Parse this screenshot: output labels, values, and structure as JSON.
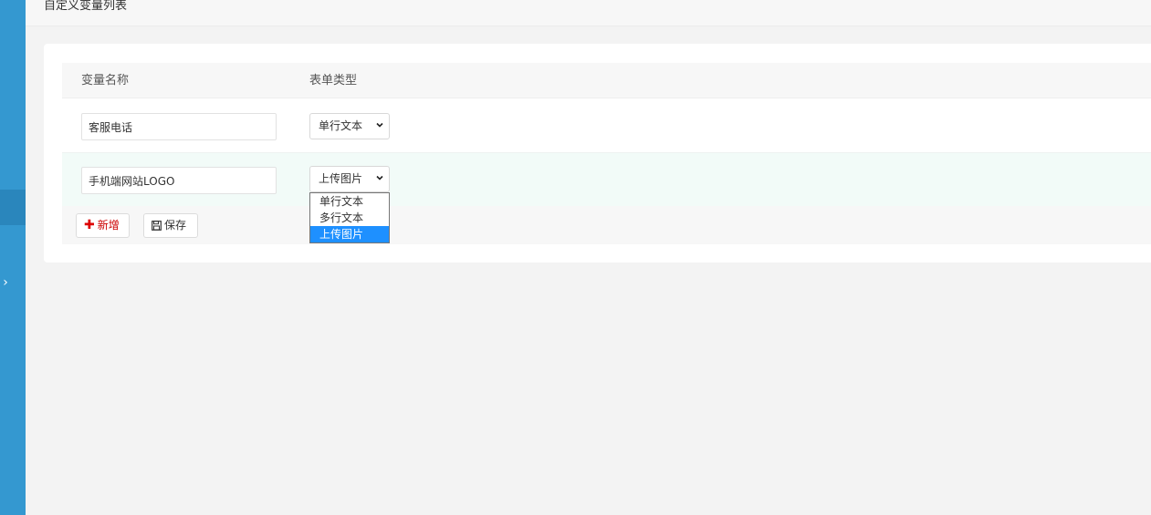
{
  "page": {
    "title": "自定义变量列表"
  },
  "table": {
    "headers": {
      "name": "变量名称",
      "type": "表单类型"
    },
    "rows": [
      {
        "name": "客服电话",
        "type": "单行文本"
      },
      {
        "name": "手机端网站LOGO",
        "type": "上传图片"
      }
    ]
  },
  "buttons": {
    "add": "新增",
    "save": "保存"
  },
  "dropdown": {
    "options": [
      "单行文本",
      "多行文本",
      "上传图片"
    ],
    "selected": "上传图片"
  },
  "icons": {
    "expand": "chevron-right-icon",
    "add": "plus-icon",
    "save": "floppy-disk-icon",
    "select": "chevron-down-icon"
  },
  "colors": {
    "sidebar": "#3498d0",
    "selected_option": "#1e90ff",
    "add_text": "#cc0000",
    "row_highlight": "#f2fbf8"
  }
}
